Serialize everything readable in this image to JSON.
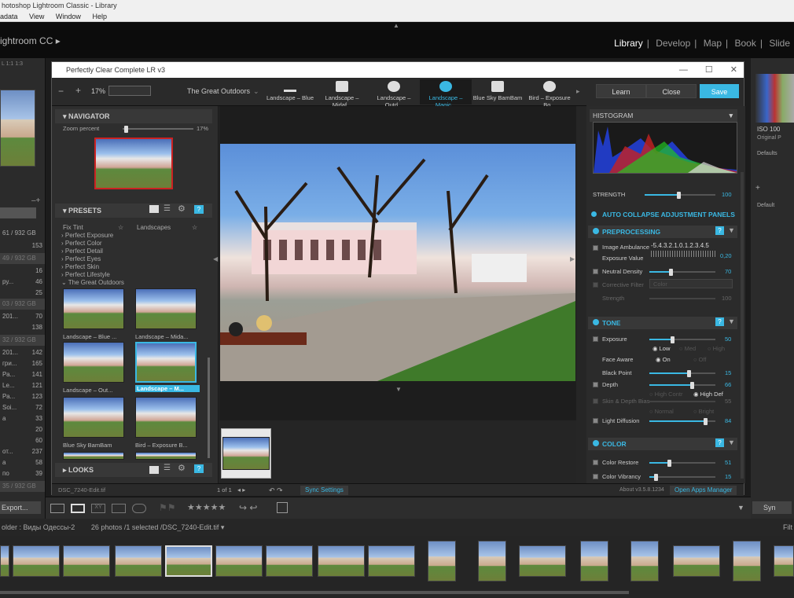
{
  "app_title": "hotoshop Lightroom Classic - Library",
  "menu": [
    "adata",
    "View",
    "Window",
    "Help"
  ],
  "lr_brand": "ightroom CC ▸",
  "modules": [
    "Library",
    "Develop",
    "Map",
    "Book",
    "Slide"
  ],
  "left_sidebar": {
    "zoom_labels": "L  1:1  1:3",
    "rows": [
      {
        "a": "",
        "b": "16"
      },
      {
        "a": "",
        "b": "153"
      },
      {
        "a": "",
        "b": "16"
      },
      {
        "a": "ру...",
        "b": "46"
      },
      {
        "a": "",
        "b": "25"
      },
      {
        "a": "201...",
        "b": "70"
      },
      {
        "a": "",
        "b": "138"
      },
      {
        "a": "201...",
        "b": "142"
      },
      {
        "a": "гри...",
        "b": "165"
      },
      {
        "a": "Ра...",
        "b": "141"
      },
      {
        "a": "Le...",
        "b": "121"
      },
      {
        "a": "Ра...",
        "b": "123"
      },
      {
        "a": "Soi...",
        "b": "72"
      },
      {
        "a": "а",
        "b": "33"
      },
      {
        "a": "",
        "b": "20"
      },
      {
        "a": "",
        "b": "60"
      },
      {
        "a": "от...",
        "b": "237"
      },
      {
        "a": "а",
        "b": "58"
      },
      {
        "a": "по",
        "b": "39"
      }
    ],
    "hdr_rows": [
      "61 / 932 GB",
      "49 / 932 GB",
      "03 / 932 GB",
      "32 / 932 GB",
      "35 / 932 GB"
    ],
    "export": "Export..."
  },
  "right_sidebar": {
    "iso": "ISO 100",
    "original": "Original P",
    "defaults": "Defaults",
    "default": "Default",
    "sync": "Syn"
  },
  "plugin": {
    "title": "Perfectly Clear Complete LR v3",
    "zoom": "17%",
    "preset_group": "The Great Outdoors",
    "preset_strip": [
      "Landscape – Blue ...",
      "Landscape – Midaf...",
      "Landscape – Outd...",
      "Landscape – Magic...",
      "Blue Sky BamBam",
      "Bird – Exposure Bo..."
    ],
    "buttons": {
      "learn": "Learn",
      "close": "Close",
      "save": "Save"
    },
    "navigator": {
      "title": "NAVIGATOR",
      "zoom_label": "Zoom percent",
      "zoom_value": "17%"
    },
    "presets": {
      "title": "PRESETS",
      "col_headers": [
        "Fix Tint",
        "Landscapes"
      ],
      "groups": [
        "Perfect Exposure",
        "Perfect Color",
        "Perfect Detail",
        "Perfect Eyes",
        "Perfect Skin",
        "Perfect Lifestyle",
        "The Great Outdoors"
      ],
      "thumbs": [
        "Landscape – Blue ...",
        "Landscape – Mida...",
        "Landscape – Out...",
        "Landscape – M...",
        "Blue Sky BamBam",
        "Bird – Exposure B..."
      ]
    },
    "looks": {
      "title": "LOOKS"
    },
    "right": {
      "histogram": "HISTOGRAM",
      "strength_label": "STRENGTH",
      "strength_value": "100",
      "strength_level": 0.48,
      "auto_collapse": "AUTO COLLAPSE ADJUSTMENT PANELS",
      "preprocessing": "PREPROCESSING",
      "image_ambulance": "Image Ambulance",
      "ambulance_scale": "-5.4.3.2.1.0.1.2.3.4.5",
      "exposure_value_label": "Exposure Value",
      "exposure_value": "0,20",
      "neutral_density": "Neutral Density",
      "neutral_value": "70",
      "neutral_level": 0.32,
      "corrective_filter": "Corrective Filter",
      "filter_select": "Color",
      "strength2": "Strength",
      "strength2_value": "100",
      "tone": "TONE",
      "exposure": "Exposure",
      "exposure_tone_value": "50",
      "exposure_level": 0.35,
      "exp_opts": [
        "Low",
        "Med",
        "High"
      ],
      "face_aware": "Face Aware",
      "face_opts": [
        "On",
        "Off"
      ],
      "black_point": "Black Point",
      "black_value": "15",
      "black_level": 0.6,
      "depth": "Depth",
      "depth_value": "66",
      "depth_level": 0.64,
      "depth_opts": [
        "High Contr",
        "High Def"
      ],
      "skin_depth_bias": "Skin & Depth Bias",
      "skin_value": "55",
      "skin_opts": [
        "Normal",
        "Bright"
      ],
      "light_diffusion": "Light Diffusion",
      "light_value": "84",
      "light_level": 0.84,
      "color": "COLOR",
      "color_restore": "Color Restore",
      "color_restore_value": "51",
      "color_restore_level": 0.3,
      "color_vibrancy": "Color Vibrancy",
      "color_vibrancy_value": "15",
      "color_vibrancy_level": 0.1
    },
    "status": {
      "file": "DSC_7240-Edit.tif",
      "page": "1 of 1",
      "sync": "Sync Settings",
      "about": "About v3.5.8.1234",
      "open": "Open Apps Manager"
    }
  },
  "lr_toolbar": {
    "stars": "★★★★★"
  },
  "filmstrip_info": {
    "folder": "older : Виды Одессы-2",
    "count": "26 photos /1 selected /",
    "file": "DSC_7240-Edit.tif",
    "filter": "Filt"
  }
}
